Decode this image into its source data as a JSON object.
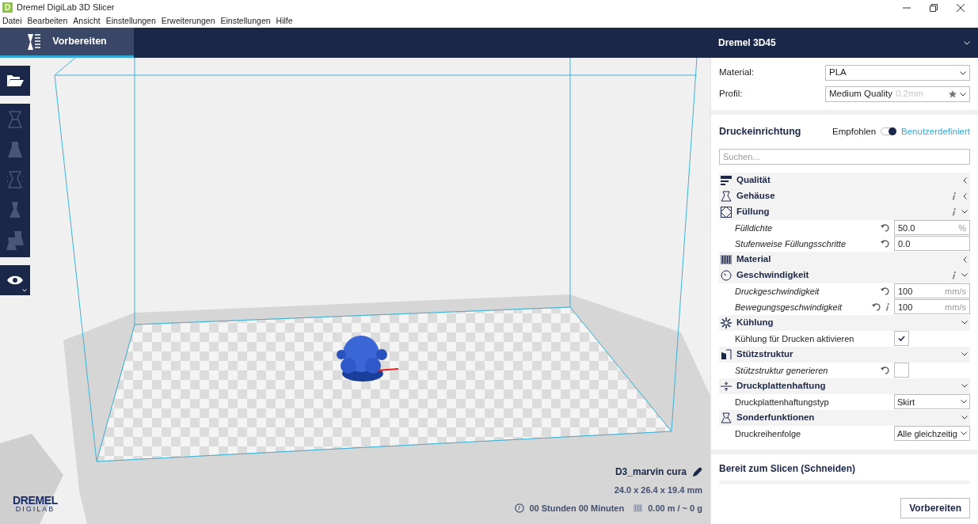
{
  "window": {
    "title": "Dremel DigiLab 3D Slicer",
    "app_icon": "D"
  },
  "menu": [
    "Datei",
    "Bearbeiten",
    "Ansicht",
    "Einstellungen",
    "Erweiterungen",
    "Einstellungen",
    "Hilfe"
  ],
  "stages": [
    {
      "label": "Vorbereiten",
      "selected": true
    }
  ],
  "printer": {
    "name": "Dremel 3D45"
  },
  "material": {
    "label": "Material:",
    "value": "PLA"
  },
  "profile": {
    "label": "Profil:",
    "value": "Medium Quality",
    "detail": "0.2mm"
  },
  "setup": {
    "title": "Druckeinrichtung",
    "recommended": "Empfohlen",
    "custom": "Benutzerdefiniert",
    "custom_on": true
  },
  "search": {
    "placeholder": "Suchen..."
  },
  "settings": [
    {
      "kind": "category",
      "label": "Qualität",
      "info": false,
      "expanded": false
    },
    {
      "kind": "category",
      "label": "Gehäuse",
      "info": true,
      "expanded": false
    },
    {
      "kind": "category",
      "label": "Füllung",
      "info": true,
      "expanded": true
    },
    {
      "kind": "number",
      "label": "Fülldichte",
      "modified": true,
      "info": false,
      "value": "50.0",
      "unit": "%"
    },
    {
      "kind": "number",
      "label": "Stufenweise Füllungsschritte",
      "modified": true,
      "info": false,
      "value": "0.0"
    },
    {
      "kind": "category",
      "label": "Material",
      "info": false,
      "expanded": false
    },
    {
      "kind": "category",
      "label": "Geschwindigkeit",
      "info": true,
      "expanded": true
    },
    {
      "kind": "number",
      "label": "Druckgeschwindigkeit",
      "modified": true,
      "info": false,
      "value": "100",
      "unit": "mm/s"
    },
    {
      "kind": "number",
      "label": "Bewegungsgeschwindigkeit",
      "modified": true,
      "info": true,
      "value": "100",
      "unit": "mm/s"
    },
    {
      "kind": "category",
      "label": "Kühlung",
      "info": false,
      "expanded": true
    },
    {
      "kind": "checkbox",
      "label": "Kühlung für Drucken aktivieren",
      "modified": false,
      "info": false,
      "checked": true
    },
    {
      "kind": "category",
      "label": "Stützstruktur",
      "info": false,
      "expanded": true
    },
    {
      "kind": "checkbox",
      "label": "Stützstruktur generieren",
      "modified": true,
      "info": false,
      "checked": false
    },
    {
      "kind": "category",
      "label": "Druckplattenhaftung",
      "info": false,
      "expanded": true
    },
    {
      "kind": "select",
      "label": "Druckplattenhaftungstyp",
      "modified": false,
      "info": false,
      "value": "Skirt"
    },
    {
      "kind": "category",
      "label": "Sonderfunktionen",
      "info": false,
      "expanded": true
    },
    {
      "kind": "select",
      "label": "Druckreihenfolge",
      "modified": false,
      "info": false,
      "value": "Alle gleichzeitig"
    }
  ],
  "slice": {
    "status": "Bereit zum Slicen (Schneiden)",
    "level": 0,
    "button": "Vorbereiten"
  },
  "object": {
    "name": "D3_marvin cura",
    "dimensions": "24.0 x 26.4 x 19.4 mm",
    "time": "00 Stunden 00 Minuten",
    "filament": "0.00 m / ~ 0 g"
  },
  "logo": {
    "brand": "DREMEL",
    "sub": "DIGILAB"
  }
}
